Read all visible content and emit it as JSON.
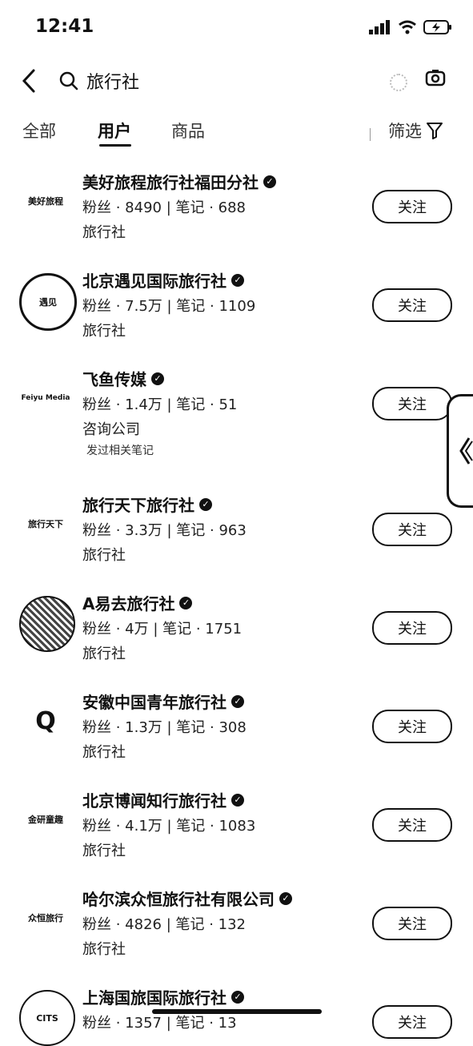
{
  "status_bar": {
    "time": "12:41"
  },
  "search": {
    "query": "旅行社"
  },
  "tabs": [
    {
      "label": "全部",
      "active": false
    },
    {
      "label": "用户",
      "active": true
    },
    {
      "label": "商品",
      "active": false
    }
  ],
  "filter_label": "筛选",
  "results": [
    {
      "name": "美好旅程旅行社福田分社",
      "stats": "粉丝 · 8490 | 笔记 · 688",
      "category": "旅行社",
      "extra": "",
      "follow": "关注",
      "avatar_text": "美好旅程"
    },
    {
      "name": "北京遇见国际旅行社",
      "stats": "粉丝 · 7.5万 | 笔记 · 1109",
      "category": "旅行社",
      "extra": "",
      "follow": "关注",
      "avatar_text": "遇见"
    },
    {
      "name": "飞鱼传媒",
      "stats": "粉丝 · 1.4万 | 笔记 · 51",
      "category": "咨询公司",
      "extra": "发过相关笔记",
      "follow": "关注",
      "avatar_text": "Feiyu Media"
    },
    {
      "name": "旅行天下旅行社",
      "stats": "粉丝 · 3.3万 | 笔记 · 963",
      "category": "旅行社",
      "extra": "",
      "follow": "关注",
      "avatar_text": "旅行天下"
    },
    {
      "name": "A易去旅行社",
      "stats": "粉丝 · 4万 | 笔记 · 1751",
      "category": "旅行社",
      "extra": "",
      "follow": "关注",
      "avatar_text": ""
    },
    {
      "name": "安徽中国青年旅行社",
      "stats": "粉丝 · 1.3万 | 笔记 · 308",
      "category": "旅行社",
      "extra": "",
      "follow": "关注",
      "avatar_text": "Q"
    },
    {
      "name": "北京博闻知行旅行社",
      "stats": "粉丝 · 4.1万 | 笔记 · 1083",
      "category": "旅行社",
      "extra": "",
      "follow": "关注",
      "avatar_text": "金研童趣"
    },
    {
      "name": "哈尔滨众恒旅行社有限公司",
      "stats": "粉丝 · 4826 | 笔记 · 132",
      "category": "旅行社",
      "extra": "",
      "follow": "关注",
      "avatar_text": "众恒旅行"
    },
    {
      "name": "上海国旅国际旅行社",
      "stats": "粉丝 · 1357 | 笔记 · 13",
      "category": "",
      "extra": "",
      "follow": "关注",
      "avatar_text": "CITS"
    }
  ]
}
